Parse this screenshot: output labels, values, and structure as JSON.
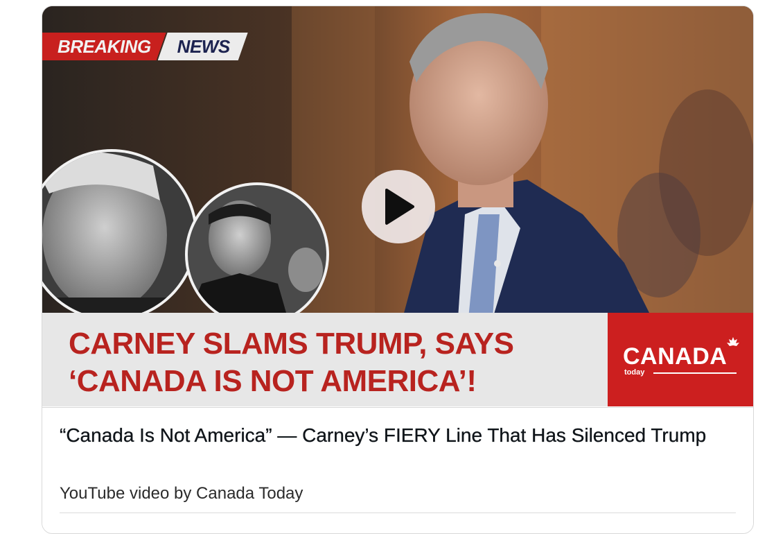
{
  "thumbnail": {
    "breaking_label": "BREAKING",
    "news_label": "NEWS",
    "headline_line1": "CARNEY SLAMS TRUMP, SAYS",
    "headline_line2": "‘CANADA IS NOT AMERICA’!",
    "brand_name": "CANADA",
    "brand_sub": "today",
    "colors": {
      "accent_red": "#c8201e",
      "headline_red": "#b8231f",
      "navy": "#1c2350"
    }
  },
  "card": {
    "title": "“Canada Is Not America” — Carney’s FIERY Line That Has Silenced Trump",
    "source": "YouTube video by Canada Today"
  },
  "icons": {
    "play": "play-icon",
    "leaf": "maple-leaf-icon"
  }
}
